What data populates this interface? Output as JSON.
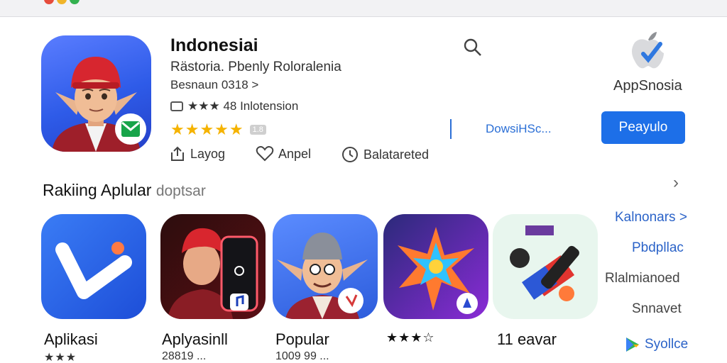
{
  "app": {
    "title": "Indonesiai",
    "subtitle": "Rästoria. Pbenly Roloralenia",
    "developer": "Besnaun 0318 >",
    "rating_text": "★★★ 48 Inlotension",
    "rating_rows": "★★★★★",
    "rating_badge": "1.8"
  },
  "actions": [
    {
      "label": "Layog"
    },
    {
      "label": "Anpel"
    },
    {
      "label": "Balatareted"
    }
  ],
  "brand": {
    "label": "AppSnosia"
  },
  "download_link": "DowsiHSc...",
  "primary_button": "Peayulo",
  "section": {
    "title": "Rakiing Aplular",
    "title_muted": "doptsar"
  },
  "tiles": [
    {
      "label": "Aplikasi",
      "sub": "★★★"
    },
    {
      "label": "Aplyasinll",
      "sub": "28819 ..."
    },
    {
      "label": "Popular",
      "sub": "1009 99 ..."
    },
    {
      "label": "★★★☆",
      "sub": ""
    },
    {
      "label": "11 eavar",
      "sub": ""
    }
  ],
  "side_links": [
    {
      "label": "Kalnonars >",
      "color": "blue"
    },
    {
      "label": "Pbdpllac",
      "color": "blue"
    },
    {
      "label": "Rlalmianoed",
      "color": "grey"
    },
    {
      "label": "Snnavet",
      "color": "grey"
    },
    {
      "label": "Syollce",
      "color": "blue"
    }
  ],
  "colors": {
    "accent": "#1d6fe8",
    "star": "#f5b300",
    "link": "#2b63c8"
  }
}
